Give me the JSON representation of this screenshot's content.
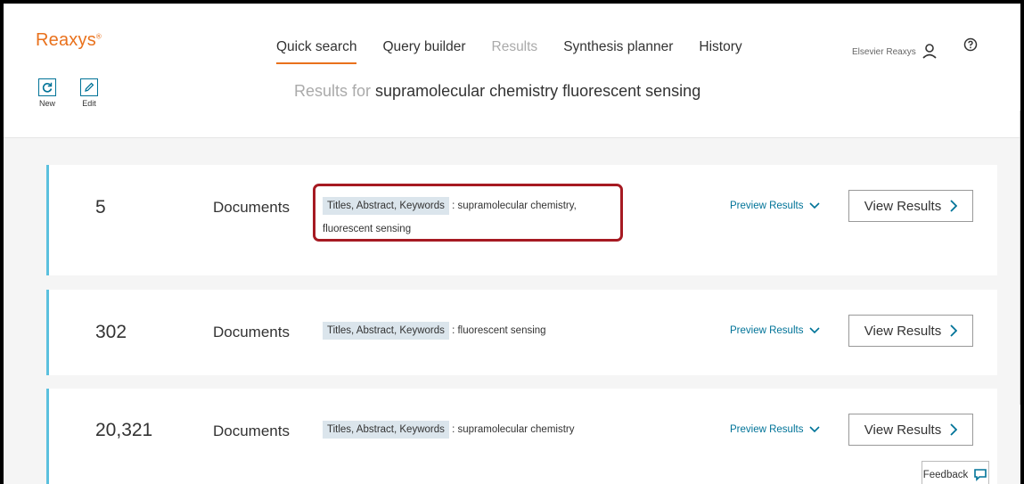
{
  "app": {
    "logo": "Reaxys",
    "logo_mark": "®"
  },
  "nav": {
    "items": [
      {
        "label": "Quick search"
      },
      {
        "label": "Query builder"
      },
      {
        "label": "Results"
      },
      {
        "label": "Synthesis planner"
      },
      {
        "label": "History"
      }
    ],
    "active": "Quick search"
  },
  "user": {
    "name": "Elsevier Reaxys"
  },
  "toolbar": {
    "new_label": "New",
    "edit_label": "Edit"
  },
  "results": {
    "prefix": "Results for",
    "query": "supramolecular chemistry fluorescent sensing"
  },
  "cards": [
    {
      "count": "5",
      "type": "Documents",
      "field": "Titles, Abstract, Keywords",
      "terms": ": supramolecular chemistry, fluorescent sensing",
      "preview": "Preview Results",
      "view": "View Results"
    },
    {
      "count": "302",
      "type": "Documents",
      "field": "Titles, Abstract, Keywords",
      "terms": ": fluorescent sensing",
      "preview": "Preview Results",
      "view": "View Results"
    },
    {
      "count": "20,321",
      "type": "Documents",
      "field": "Titles, Abstract, Keywords",
      "terms": ": supramolecular chemistry",
      "preview": "Preview Results",
      "view": "View Results"
    }
  ],
  "feedback": {
    "label": "Feedback"
  },
  "colors": {
    "accent": "#e9711c",
    "link": "#007398",
    "card_border": "#5bc0de",
    "highlight": "#a61a22",
    "tag": "#dbe5ec"
  },
  "icons": {
    "user": "user-icon",
    "help": "help-icon",
    "new": "refresh-icon",
    "edit": "pencil-icon",
    "chevron": "chevron-down-icon",
    "arrow": "chevron-right-icon",
    "feedback": "chat-icon"
  }
}
